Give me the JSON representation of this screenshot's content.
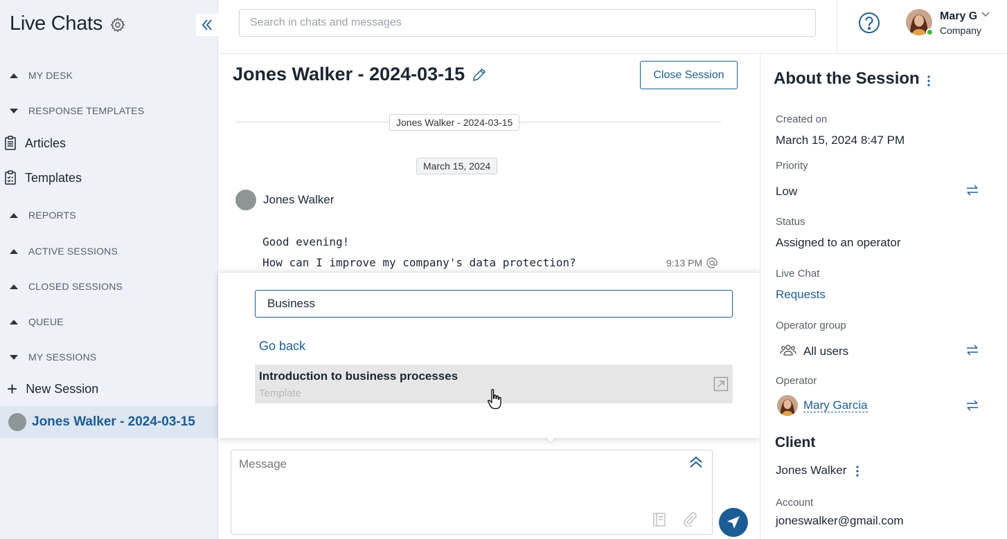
{
  "sidebar": {
    "app_title": "Live Chats",
    "sections": [
      {
        "label": "MY DESK",
        "state": "expanded-up"
      },
      {
        "label": "RESPONSE TEMPLATES",
        "state": "expanded-down"
      },
      {
        "label": "REPORTS",
        "state": "expanded-up"
      },
      {
        "label": "ACTIVE SESSIONS",
        "state": "expanded-up"
      },
      {
        "label": "CLOSED SESSIONS",
        "state": "expanded-up"
      },
      {
        "label": "QUEUE",
        "state": "expanded-up"
      },
      {
        "label": "MY SESSIONS",
        "state": "expanded-down"
      }
    ],
    "template_items": [
      {
        "label": "Articles",
        "icon": "clipboard-icon"
      },
      {
        "label": "Templates",
        "icon": "checklist-icon"
      }
    ],
    "new_session_label": "New Session",
    "active_session_label": "Jones Walker - 2024-03-15"
  },
  "topbar": {
    "search_placeholder": "Search in chats and messages",
    "user_name": "Mary G",
    "user_company": "Company"
  },
  "chat": {
    "session_title": "Jones Walker - 2024-03-15",
    "close_button": "Close Session",
    "session_chip": "Jones Walker - 2024-03-15",
    "date_chip": "March 15, 2024",
    "author": "Jones Walker",
    "lines": [
      "Good evening!",
      "How can I improve my company's data protection?"
    ],
    "time": "9:13 PM"
  },
  "popup": {
    "search_value": "Business",
    "go_back": "Go back",
    "result_title": "Introduction to business processes",
    "result_type": "Template"
  },
  "composer": {
    "placeholder": "Message"
  },
  "panel": {
    "title": "About the Session",
    "created_label": "Created on",
    "created_value": "March 15, 2024 8:47 PM",
    "priority_label": "Priority",
    "priority_value": "Low",
    "status_label": "Status",
    "status_value": "Assigned to an operator",
    "live_chat_label": "Live Chat",
    "live_chat_value": "Requests",
    "group_label": "Operator group",
    "group_value": "All users",
    "operator_label": "Operator",
    "operator_value": "Mary Garcia",
    "client_heading": "Client",
    "client_name": "Jones Walker",
    "account_label": "Account",
    "account_value": "joneswalker@gmail.com"
  },
  "colors": {
    "accent": "#1c5c94",
    "sidebar_bg": "#eef2f8",
    "active_row": "#dde6f1",
    "online": "#3fb545"
  }
}
